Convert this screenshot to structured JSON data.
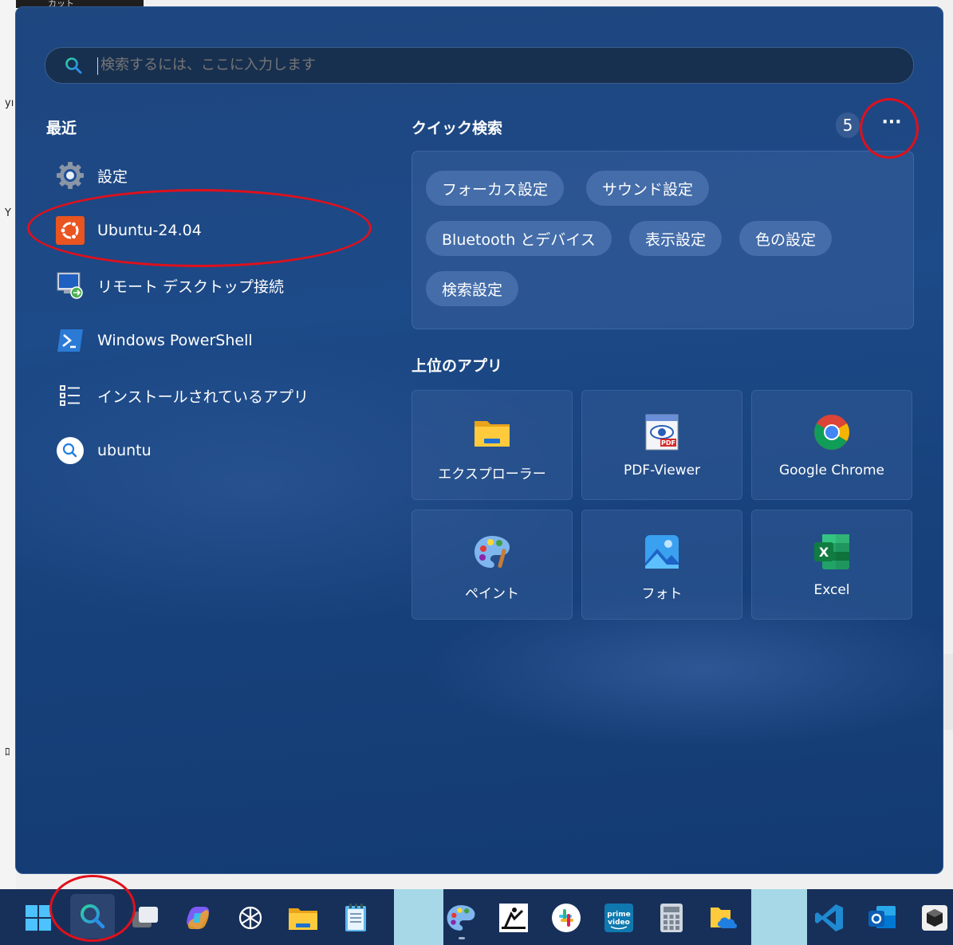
{
  "desktop": {
    "top_label": "カット",
    "side_labels": [
      "yı",
      "Y",
      "ﾛ"
    ]
  },
  "search": {
    "placeholder": "検索するには、ここに入力します"
  },
  "recent": {
    "title": "最近",
    "items": [
      {
        "label": "設定",
        "icon": "settings-gear-icon"
      },
      {
        "label": "Ubuntu-24.04",
        "icon": "ubuntu-icon"
      },
      {
        "label": "リモート デスクトップ接続",
        "icon": "remote-desktop-icon"
      },
      {
        "label": "Windows PowerShell",
        "icon": "powershell-icon"
      },
      {
        "label": "インストールされているアプリ",
        "icon": "installed-apps-list-icon"
      },
      {
        "label": "ubuntu",
        "icon": "search-icon"
      }
    ]
  },
  "quick_search": {
    "title": "クイック検索",
    "count": "5",
    "more": "···",
    "chips": [
      "フォーカス設定",
      "サウンド設定",
      "Bluetooth とデバイス",
      "表示設定",
      "色の設定",
      "検索設定"
    ]
  },
  "top_apps": {
    "title": "上位のアプリ",
    "apps": [
      {
        "label": "エクスプローラー",
        "icon": "file-explorer-icon"
      },
      {
        "label": "PDF-Viewer",
        "icon": "pdf-viewer-icon"
      },
      {
        "label": "Google Chrome",
        "icon": "chrome-icon"
      },
      {
        "label": "ペイント",
        "icon": "paint-icon"
      },
      {
        "label": "フォト",
        "icon": "photos-icon"
      },
      {
        "label": "Excel",
        "icon": "excel-icon"
      }
    ]
  },
  "taskbar": {
    "icons": [
      "windows-start-icon",
      "search-icon",
      "task-view-icon",
      "copilot-icon",
      "chatgpt-icon",
      "file-explorer-icon",
      "notepad-icon",
      "paint-icon",
      "kindle-icon",
      "slack-icon",
      "prime-video-icon",
      "calculator-icon",
      "onedrive-folder-icon",
      "vscode-icon",
      "outlook-icon",
      "app-cube-icon"
    ],
    "prime_text": "prime video"
  },
  "colors": {
    "panel": "#1d4a88",
    "annotation_red": "#e0101b",
    "ubuntu_orange": "#e95420"
  }
}
